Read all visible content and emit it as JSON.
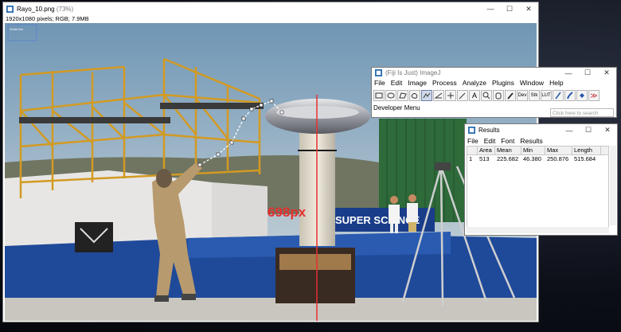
{
  "image_window": {
    "title": "Rayo_10.png",
    "zoom": "(73%)",
    "info": "1920x1080 pixels; RGB; 7.9MB",
    "overlay_tag": "Scale bar",
    "measure_label": "698px",
    "sign_text": "SUPER SCIENCE",
    "controls": {
      "minimize": "—",
      "maximize": "☐",
      "close": "✕"
    }
  },
  "fiji_window": {
    "title": "(Fiji Is Just) ImageJ",
    "menu": [
      "File",
      "Edit",
      "Image",
      "Process",
      "Analyze",
      "Plugins",
      "Window",
      "Help"
    ],
    "tools": [
      {
        "icon": "rectangle-tool-icon",
        "label": ""
      },
      {
        "icon": "oval-tool-icon",
        "label": ""
      },
      {
        "icon": "polygon-tool-icon",
        "label": ""
      },
      {
        "icon": "freehand-tool-icon",
        "label": ""
      },
      {
        "icon": "segmented-line-tool-icon",
        "label": ""
      },
      {
        "icon": "angle-tool-icon",
        "label": ""
      },
      {
        "icon": "point-tool-icon",
        "label": ""
      },
      {
        "icon": "wand-tool-icon",
        "label": ""
      },
      {
        "icon": "text-tool-icon",
        "label": "A"
      },
      {
        "icon": "magnifier-tool-icon",
        "label": ""
      },
      {
        "icon": "scroll-tool-icon",
        "label": ""
      },
      {
        "icon": "dropper-tool-icon",
        "label": ""
      },
      {
        "icon": "developer-tool-icon",
        "label": "Dev"
      },
      {
        "icon": "stack-tool-icon",
        "label": "Stk"
      },
      {
        "icon": "lut-tool-icon",
        "label": "LUT"
      },
      {
        "icon": "pencil-tool-icon",
        "label": ""
      },
      {
        "icon": "brush-tool-icon",
        "label": ""
      },
      {
        "icon": "flood-fill-tool-icon",
        "label": ""
      },
      {
        "icon": "more-tools-icon",
        "label": "≫"
      }
    ],
    "status": "Developer Menu",
    "search_placeholder": "Click here to search",
    "controls": {
      "minimize": "—",
      "maximize": "☐",
      "close": "✕"
    }
  },
  "results_window": {
    "title": "Results",
    "menu": [
      "File",
      "Edit",
      "Font",
      "Results"
    ],
    "columns": [
      "",
      "Area",
      "Mean",
      "Min",
      "Max",
      "Length"
    ],
    "rows": [
      [
        "1",
        "513",
        "225.682",
        "46.380",
        "250.876",
        "515.684"
      ]
    ],
    "controls": {
      "minimize": "—",
      "maximize": "☐",
      "close": "✕"
    }
  },
  "colors": {
    "measure": "#e53030",
    "sky": "#9db4c6",
    "ground": "#1f4a9a"
  }
}
